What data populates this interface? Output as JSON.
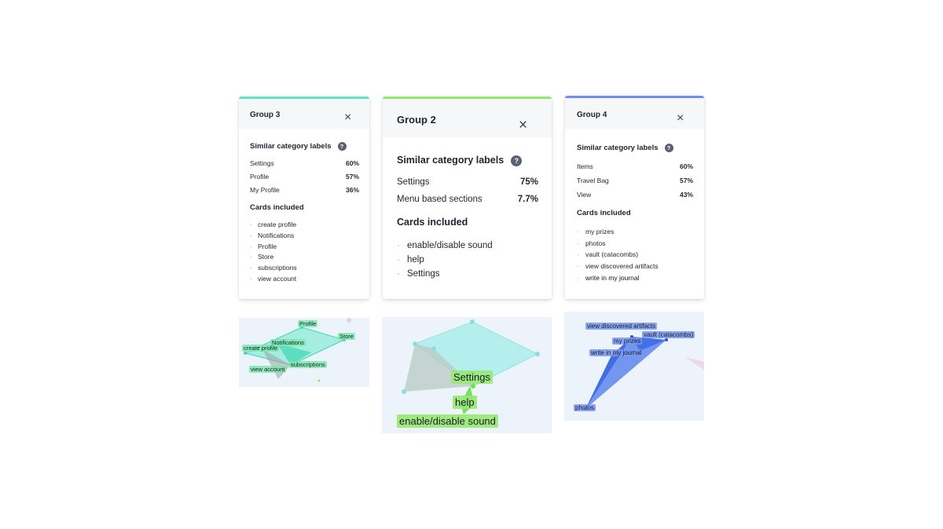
{
  "colors": {
    "group3": "#5ee6c3",
    "group2": "#8ee86a",
    "group4": "#6e8ff0"
  },
  "group3": {
    "title": "Group 3",
    "close_icon": "×",
    "similar_heading": "Similar category labels",
    "help_icon": "?",
    "labels": [
      {
        "name": "Settings",
        "pct": "60%"
      },
      {
        "name": "Profile",
        "pct": "57%"
      },
      {
        "name": "My Profile",
        "pct": "36%"
      }
    ],
    "cards_heading": "Cards included",
    "cards": [
      "create profile",
      "Notifications",
      "Profile",
      "Store",
      "subscriptions",
      "view account"
    ],
    "map_tags": [
      "Profile",
      "Store",
      "Notifications",
      "create profile",
      "subscriptions",
      "view account"
    ]
  },
  "group2": {
    "title": "Group 2",
    "close_icon": "×",
    "similar_heading": "Similar category labels",
    "help_icon": "?",
    "labels": [
      {
        "name": "Settings",
        "pct": "75%"
      },
      {
        "name": "Menu based sections",
        "pct": "7.7%"
      }
    ],
    "cards_heading": "Cards included",
    "cards": [
      "enable/disable sound",
      "help",
      "Settings"
    ],
    "map_tags": [
      "Settings",
      "help",
      "enable/disable sound"
    ]
  },
  "group4": {
    "title": "Group 4",
    "close_icon": "×",
    "similar_heading": "Similar category labels",
    "help_icon": "?",
    "labels": [
      {
        "name": "Items",
        "pct": "60%"
      },
      {
        "name": "Travel Bag",
        "pct": "57%"
      },
      {
        "name": "View",
        "pct": "43%"
      }
    ],
    "cards_heading": "Cards included",
    "cards": [
      "my prizes",
      "photos",
      "vault (catacombs)",
      "view discovered artifacts",
      "write in my journal"
    ],
    "map_tags": [
      "view discovered artifacts",
      "vault (catacombs)",
      "my prizes",
      "write in my journal",
      "photos"
    ]
  }
}
